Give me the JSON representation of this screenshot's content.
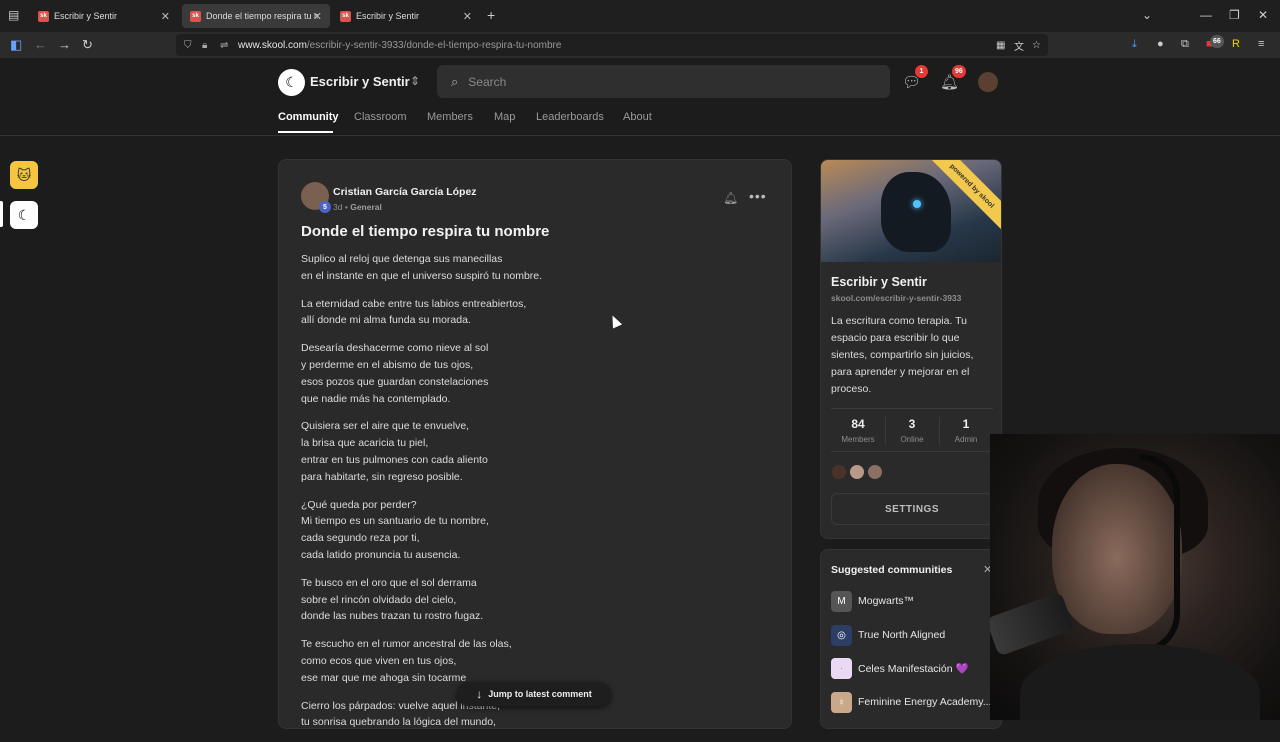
{
  "browser": {
    "tabs": [
      {
        "title": "Escribir y Sentir"
      },
      {
        "title": "Donde el tiempo respira tu nombre"
      },
      {
        "title": "Escribir y Sentir"
      }
    ],
    "favicon_text": "sk",
    "new_tab": "+",
    "url_host": "www.skool.com",
    "url_path": "/escribir-y-sentir-3933/donde-el-tiempo-respira-tu-nombre",
    "extension_badge": "66"
  },
  "header": {
    "community_name": "Escribir y Sentir",
    "search_placeholder": "Search",
    "chat_badge": "1",
    "notifications_badge": "96",
    "nav": [
      "Community",
      "Classroom",
      "Members",
      "Map",
      "Leaderboards",
      "About"
    ]
  },
  "post": {
    "author": "Cristian García García López",
    "level": "5",
    "time": "3d",
    "separator": "•",
    "category": "General",
    "title": "Donde el tiempo respira tu nombre",
    "stanzas": [
      [
        "Suplico al reloj que detenga sus manecillas",
        "en el instante en que el universo suspiró tu nombre."
      ],
      [
        "La eternidad cabe entre tus labios entreabiertos,",
        "allí donde mi alma funda su morada."
      ],
      [
        "Desearía deshacerme como nieve al sol",
        "y perderme en el abismo de tus ojos,",
        "esos pozos que guardan constelaciones",
        "que nadie más ha contemplado."
      ],
      [
        "Quisiera ser el aire que te envuelve,",
        "la brisa que acaricia tu piel,",
        "entrar en tus pulmones con cada aliento",
        "para habitarte, sin regreso posible."
      ],
      [
        "¿Qué queda por perder?",
        "Mi tiempo es un santuario de tu nombre,",
        "cada segundo reza por ti,",
        "cada latido pronuncia tu ausencia."
      ],
      [
        "Te busco en el oro que el sol derrama",
        "sobre el rincón olvidado del cielo,",
        "donde las nubes trazan tu rostro fugaz."
      ],
      [
        "Te escucho en el rumor ancestral de las olas,",
        "como ecos que viven en tus ojos,",
        "ese mar que me ahoga sin tocarme"
      ],
      [
        "Cierro los párpados: vuelve aquel instante,",
        "tu sonrisa quebrando la lógica del mundo,"
      ]
    ],
    "jump_label": "Jump to latest comment"
  },
  "community_card": {
    "ribbon": "powered by skool",
    "name": "Escribir y Sentir",
    "url": "skool.com/escribir-y-sentir-3933",
    "description": "La escritura como terapia. Tu espacio para escribir lo que sientes, compartirlo sin juicios, para aprender y mejorar en el proceso.",
    "stats": [
      {
        "value": "84",
        "label": "Members"
      },
      {
        "value": "3",
        "label": "Online"
      },
      {
        "value": "1",
        "label": "Admin"
      }
    ],
    "settings_label": "SETTINGS"
  },
  "suggested": {
    "title": "Suggested communities",
    "items": [
      {
        "name": "Mogwarts™",
        "color": "#555555",
        "glyph": "M"
      },
      {
        "name": "True North Aligned",
        "color": "#2c3e66",
        "glyph": "◎"
      },
      {
        "name": "Celes Manifestación 💜",
        "color": "#e9d9f2",
        "glyph": "·"
      },
      {
        "name": "Feminine Energy Academy...",
        "color": "#c9a98a",
        "glyph": "♀"
      }
    ]
  },
  "colors": {
    "accent_badge": "#e53935",
    "ribbon": "#f2c94c"
  }
}
